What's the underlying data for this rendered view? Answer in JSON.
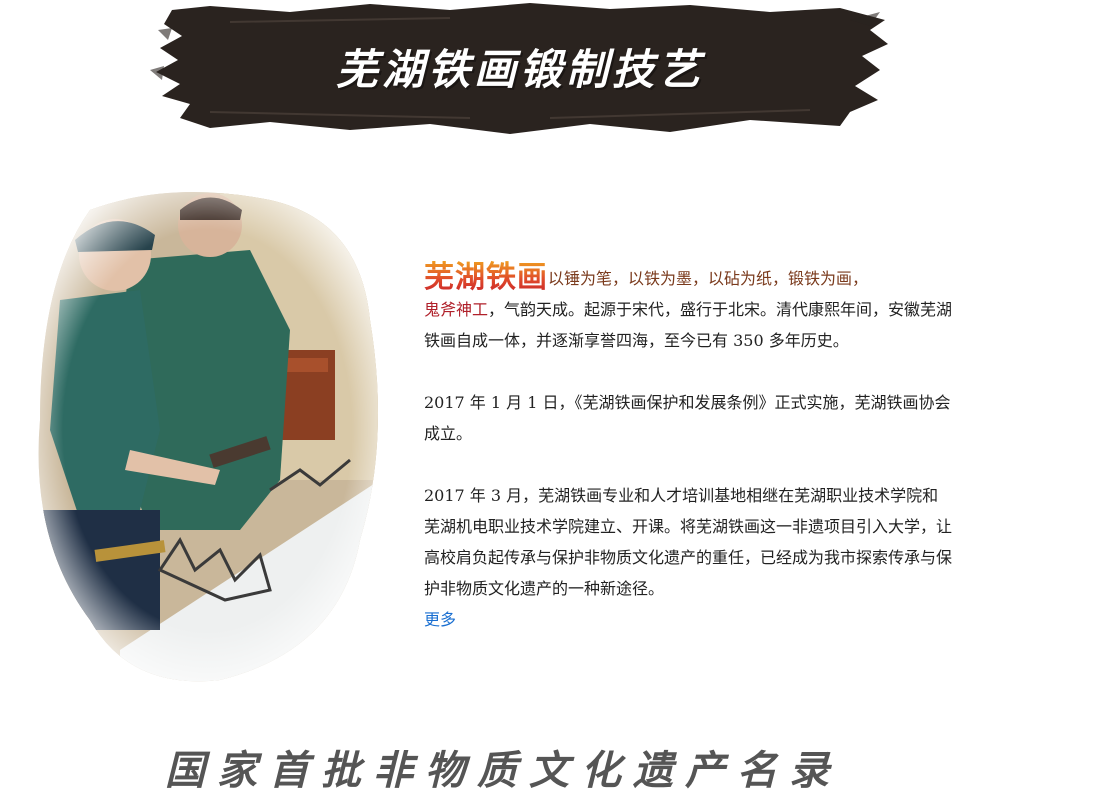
{
  "banner": {
    "title": "芜湖铁画锻制技艺"
  },
  "photo": {
    "alt": "Artisans forging iron pictures"
  },
  "intro": {
    "title": "芜湖铁画",
    "part1": "以锤为笔，以铁为墨，以砧为纸，锻铁为画，",
    "part2": "鬼斧神工",
    "part3": "，气韵天成。起源于宋代，盛行于北宋。清代康熙年间，安徽芜湖铁画自成一体，并逐渐享誉四海，至今已有 350 多年历史。"
  },
  "paragraph2": "2017 年 1 月 1 日，《芜湖铁画保护和发展条例》正式实施，芜湖铁画协会成立。",
  "paragraph3": "2017 年 3 月，芜湖铁画专业和人才培训基地相继在芜湖职业技术学院和芜湖机电职业技术学院建立、开课。将芜湖铁画这一非遗项目引入大学，让高校肩负起传承与保护非物质文化遗产的重任，已经成为我市探索传承与保护非物质文化遗产的一种新途径。",
  "more_link": "更多",
  "footer": {
    "title": "国家首批非物质文化遗产名录"
  },
  "colors": {
    "banner_ink": "#2a231f",
    "link": "#1a6fd1",
    "title_gradient_top": "#f0a020",
    "title_gradient_bottom": "#c7222a"
  }
}
